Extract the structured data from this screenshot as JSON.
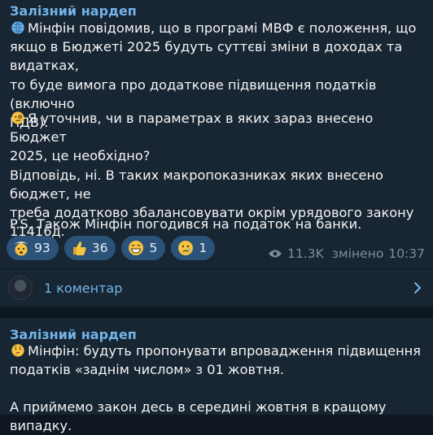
{
  "post1": {
    "author": "Залізний нардеп",
    "paragraphs": [
      {
        "icon": "globe-icon",
        "text": "Мінфін повідомив, що в програмі МВФ є положення, що\nякщо в Бюджеті 2025 будуть суттєві зміни в доходах та видатках,\nто буде вимога про додаткове підвищення податків (включно\nПДВ)."
      },
      {
        "icon": "monocle-face-icon",
        "text": "Я уточнив, чи в параметрах в яких зараз внесено Бюджет\n2025, це необхідно?\nВідповідь, ні. В таких макропоказниках яких внесено бюджет, не\nтреба додатково збалансовувати окрім урядового закону\n11416д."
      },
      {
        "icon": "",
        "text": "P.S. Також Мінфін погодився на податок на банки."
      }
    ],
    "reactions": [
      {
        "emoji": "exploding-head-icon",
        "count": "93"
      },
      {
        "emoji": "thumbs-up-icon",
        "count": "36"
      },
      {
        "emoji": "grinning-face-icon",
        "count": "5"
      },
      {
        "emoji": "crying-face-icon",
        "count": "1"
      }
    ],
    "views": "11.3K",
    "edited": "змінено",
    "time": "10:37",
    "comments_label": "1 коментар"
  },
  "post2": {
    "author": "Залізний нардеп",
    "paragraphs": [
      {
        "icon": "thinking-face-icon",
        "text": "Мінфін: будуть пропонувати впровадження підвищення\nподатків «заднім числом» з 01 жовтня."
      },
      {
        "icon": "",
        "text": "А приймемо закон десь в середині жовтня в кращому випадку."
      }
    ]
  }
}
